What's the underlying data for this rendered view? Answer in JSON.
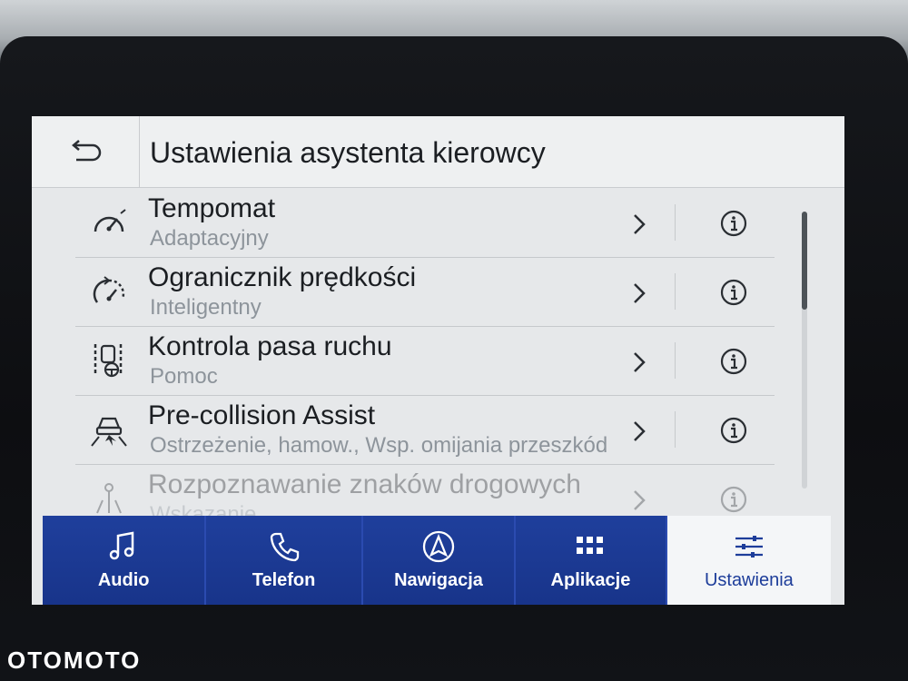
{
  "header": {
    "title": "Ustawienia asystenta kierowcy",
    "back_icon": "back-arrow-icon"
  },
  "rows": [
    {
      "label": "Tempomat",
      "sub": "Adaptacyjny",
      "icon": "speedometer-icon"
    },
    {
      "label": "Ogranicznik prędkości",
      "sub": "Inteligentny",
      "icon": "speed-limiter-icon"
    },
    {
      "label": "Kontrola pasa ruchu",
      "sub": "Pomoc",
      "icon": "lane-keeping-icon"
    },
    {
      "label": "Pre-collision Assist",
      "sub": "Ostrzeżenie, hamow., Wsp. omijania przeszkód",
      "icon": "collision-car-icon"
    },
    {
      "label": "Rozpoznawanie znaków drogowych",
      "sub": "Wskazanie",
      "icon": "traffic-sign-icon"
    }
  ],
  "nav": [
    {
      "label": "Audio",
      "icon": "music-note-icon",
      "active": false
    },
    {
      "label": "Telefon",
      "icon": "phone-icon",
      "active": false
    },
    {
      "label": "Nawigacja",
      "icon": "navigation-icon",
      "active": false
    },
    {
      "label": "Aplikacje",
      "icon": "apps-grid-icon",
      "active": false
    },
    {
      "label": "Ustawienia",
      "icon": "settings-sliders-icon",
      "active": true
    }
  ],
  "watermark": "OTOMOTO",
  "colors": {
    "nav_blue": "#1f3f9c",
    "active_text": "#1d3d9a",
    "screen_bg": "#e6e8ea",
    "subtext": "#8d949b"
  }
}
